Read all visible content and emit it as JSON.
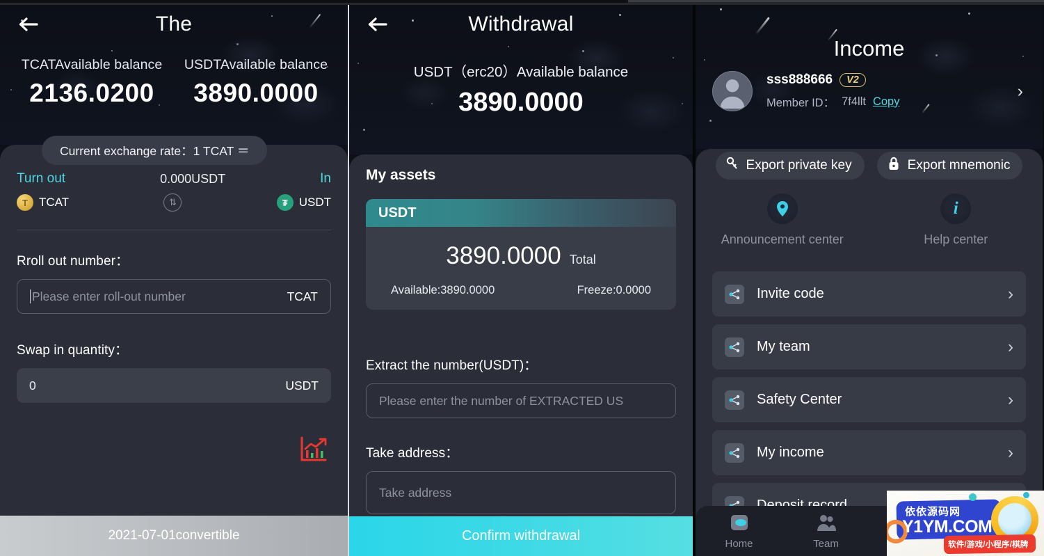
{
  "panel_exchange": {
    "nav_title": "The",
    "back_icon": "back-arrow-icon",
    "balances": [
      {
        "label": "TCATAvailable balance",
        "value": "2136.0200"
      },
      {
        "label": "USDTAvailable balance",
        "value": "3890.0000"
      }
    ],
    "rate_pill": "Current exchange rate：1 TCAT ＝",
    "swap": {
      "turn_out_label": "Turn out",
      "amount": "0.000USDT",
      "in_label": "In",
      "from_symbol": "TCAT",
      "to_symbol": "USDT",
      "from_icon": "tcat-coin-icon",
      "to_icon": "usdt-tether-icon",
      "swap_icon": "swap-circle-icon"
    },
    "rollout": {
      "label": "Rroll out number：",
      "placeholder": "Please enter roll-out number",
      "unit": "TCAT"
    },
    "swapin": {
      "label": "Swap in quantity：",
      "value": "0",
      "unit": "USDT"
    },
    "chart_icon": "chart-trend-icon",
    "bottom_button": "2021-07-01convertible"
  },
  "panel_withdrawal": {
    "nav_title": "Withdrawal",
    "back_icon": "back-arrow-icon",
    "subtitle": "USDT（erc20）Available balance",
    "amount": "3890.0000",
    "section_title": "My assets",
    "asset_card": {
      "symbol": "USDT",
      "total_value": "3890.0000",
      "total_label": "Total",
      "available": "Available:3890.0000",
      "freeze": "Freeze:0.0000"
    },
    "extract": {
      "label": "Extract the number(USDT)：",
      "placeholder": "Please enter the number of EXTRACTED US"
    },
    "address": {
      "label": "Take address：",
      "placeholder": "Take address"
    },
    "bottom_button": "Confirm withdrawal"
  },
  "panel_income": {
    "title": "Income",
    "avatar_icon": "user-avatar-icon",
    "user_name": "sss888666",
    "vip_badge": "V2",
    "member_id_label": "Member ID：",
    "member_id_value": "7f4llt",
    "copy_label": "Copy",
    "profile_chevron": "chevron-right-icon",
    "export_buttons": [
      {
        "label": "Export private key",
        "icon": "key-icon"
      },
      {
        "label": "Export mnemonic",
        "icon": "lock-icon"
      }
    ],
    "centers": [
      {
        "label": "Announcement center",
        "icon": "location-pin-icon"
      },
      {
        "label": "Help center",
        "icon": "info-icon"
      }
    ],
    "menu_items": [
      {
        "label": "Invite code",
        "icon": "share-nodes-icon"
      },
      {
        "label": "My team",
        "icon": "share-nodes-icon"
      },
      {
        "label": "Safety Center",
        "icon": "share-nodes-icon"
      },
      {
        "label": "My income",
        "icon": "share-nodes-icon"
      },
      {
        "label": "Deposit record",
        "icon": "share-nodes-icon"
      }
    ],
    "tabs": [
      {
        "label": "Home",
        "icon": "home-icon",
        "active": true
      },
      {
        "label": "Team",
        "icon": "team-icon",
        "active": false
      }
    ]
  },
  "watermark": {
    "cn_text": "依依源码网",
    "en_text": "Y1YM.COM",
    "tag_text": "软件/游戏/小程序/棋牌"
  },
  "colors": {
    "accent_cyan": "#4fd6e0",
    "sheet_bg": "#2b2e38",
    "hero_bg": "#0c0f17",
    "usdt_green": "#26a17b",
    "confirm_button": "#2ad6e8",
    "vip_gold": "#e7d17c"
  }
}
